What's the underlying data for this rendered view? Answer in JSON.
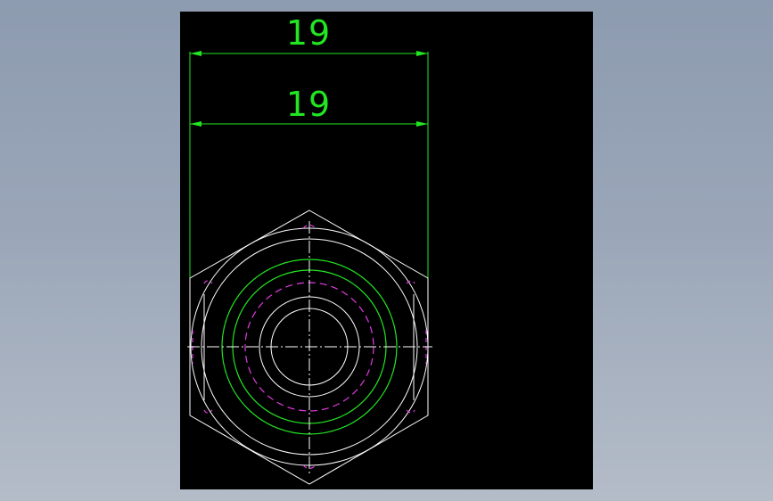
{
  "canvas": {
    "background_color": "#000000",
    "outer_background": "#95a3b6"
  },
  "colors": {
    "dimension": "#22e622",
    "outline": "#ffffff",
    "hidden_line": "#e23ce2",
    "circle_green": "#22e622",
    "centerline": "#ffffff"
  },
  "dimensions": {
    "top": {
      "value": "19"
    },
    "second": {
      "value": "19"
    }
  }
}
